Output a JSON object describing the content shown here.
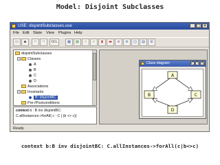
{
  "slide": {
    "title": "Model: Disjoint Subclasses",
    "caption": "context b:B inv disjointBC: C.allInstances->forAll(c|b<>c)"
  },
  "window": {
    "title": "USE: disjointSubclasses.use",
    "controls": [
      "_",
      "□",
      "×"
    ]
  },
  "menu": [
    "File",
    "Edit",
    "State",
    "View",
    "Plugins",
    "Help"
  ],
  "toolbar": {
    "buttons": [
      {
        "name": "open-icon",
        "glyph": "▭"
      },
      {
        "name": "save-icon",
        "glyph": "▪"
      },
      {
        "name": "undo-icon",
        "glyph": "↶"
      },
      {
        "name": "redo-icon",
        "glyph": "↷"
      },
      {
        "name": "ocl-button",
        "glyph": "OCL"
      },
      {
        "name": "class-diagram-icon",
        "glyph": "▦"
      },
      {
        "name": "object-diagram-icon",
        "glyph": "▧"
      },
      {
        "name": "sequence-diagram-icon",
        "glyph": "⚡"
      },
      {
        "name": "class-invariant-icon",
        "glyph": "✓"
      },
      {
        "name": "object-count-icon",
        "glyph": "▮"
      },
      {
        "name": "link-count-icon",
        "glyph": "▬"
      },
      {
        "name": "state-evolution-icon",
        "glyph": "≋"
      },
      {
        "name": "call-stack-icon",
        "glyph": "≡"
      },
      {
        "name": "object-properties-icon",
        "glyph": "◫"
      },
      {
        "name": "class-extent-icon",
        "glyph": "▤"
      },
      {
        "name": "command-list-icon",
        "glyph": "☰"
      }
    ]
  },
  "tree": {
    "root": "disjointSubclasses",
    "classes_label": "Classes",
    "classes": [
      "A",
      "B",
      "C",
      "D"
    ],
    "associations_label": "Associations",
    "invariants_label": "Invariants",
    "invariant_selected": "B::disjointBC",
    "prepost_label": "Pre-/Postconditions"
  },
  "ocl_view": {
    "line1_keyword": "context",
    "line1_rest": " b : B inv disjointBC:",
    "line2": "C.allInstances->forAll( c : C | (b <> c))"
  },
  "diagram_window": {
    "title": "Class diagram",
    "controls": [
      "⤢",
      "⤡",
      "×"
    ],
    "classes": [
      "A",
      "B",
      "C",
      "D"
    ]
  },
  "status": "Ready."
}
